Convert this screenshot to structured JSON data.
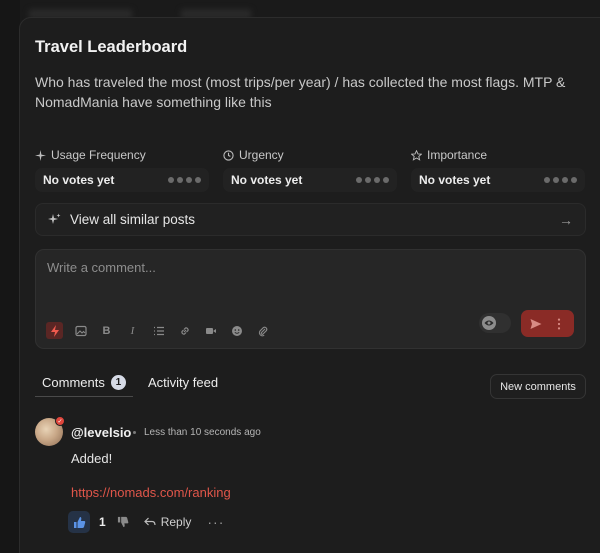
{
  "post": {
    "title": "Travel Leaderboard",
    "description": "Who has traveled the most (most trips/per year) / has collected the most flags. MTP & NomadMania have something like this"
  },
  "metrics": [
    {
      "label": "Usage Frequency",
      "icon": "sparkle-icon",
      "value": "No votes yet"
    },
    {
      "label": "Urgency",
      "icon": "clock-icon",
      "value": "No votes yet"
    },
    {
      "label": "Importance",
      "icon": "star-icon",
      "value": "No votes yet"
    }
  ],
  "similar": {
    "label": "View all similar posts",
    "icon": "sparkles-icon"
  },
  "composer": {
    "placeholder": "Write a comment..."
  },
  "tabs": {
    "comments_label": "Comments",
    "comments_count": "1",
    "activity_label": "Activity feed",
    "new_comments_label": "New comments"
  },
  "comment": {
    "author": "@levelsio",
    "time": "Less than 10 seconds ago",
    "text": "Added!",
    "link": "https://nomads.com/ranking",
    "like_count": "1",
    "reply_label": "Reply",
    "more_label": "···"
  },
  "colors": {
    "accent": "#e0564a",
    "send": "#8a2b26",
    "like": "#253246"
  }
}
